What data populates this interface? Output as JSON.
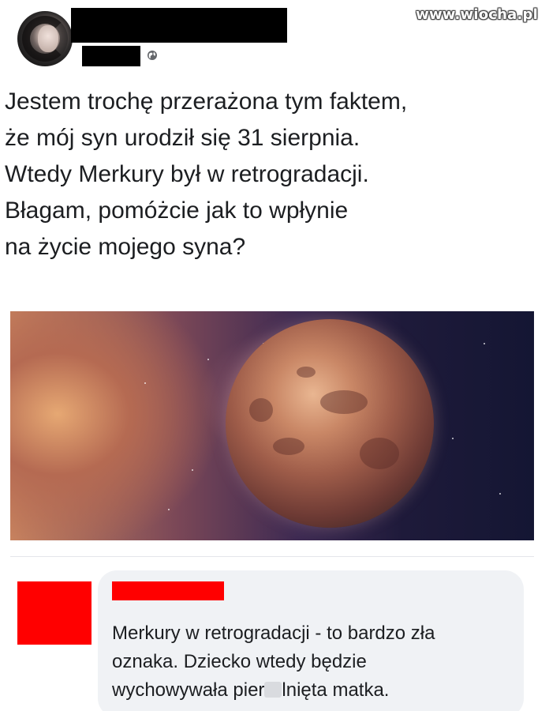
{
  "watermark": {
    "text": "www.wiocha.pl"
  },
  "post": {
    "text": "Jestem trochę przerażona tym faktem,\nże mój syn urodził się 31 sierpnia.\nWtedy Merkury był w retrogradacji.\nBłagam, pomóżcie jak to wpłynie\nna życie mojego syna?",
    "privacy_icon": "globe-icon"
  },
  "comment": {
    "text_before": "Merkury w retrogradacji - to bardzo zła\noznaka. Dziecko wtedy będzie\nwychowywała pier",
    "text_after": "lnięta matka."
  },
  "colors": {
    "redaction_black": "#000000",
    "redaction_red": "#ff0000",
    "comment_bubble": "#f0f2f5"
  }
}
